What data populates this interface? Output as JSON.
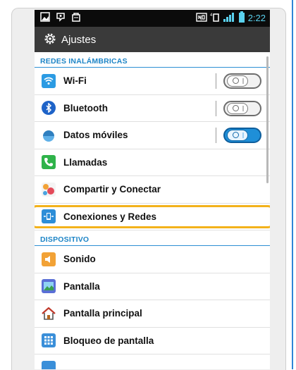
{
  "statusbar": {
    "clock": "2:22",
    "left_icons": [
      "gallery-icon",
      "sync-icon",
      "bag-icon"
    ],
    "right_icons": [
      "nfc-icon",
      "data-icon",
      "signal-icon",
      "battery-icon"
    ]
  },
  "titlebar": {
    "title": "Ajustes",
    "icon": "gear-icon"
  },
  "sections": [
    {
      "header": "REDES INALÁMBRICAS",
      "items": [
        {
          "label": "Wi-Fi",
          "icon": "wifi-icon",
          "icon_color": "#2b9be3",
          "toggle": "off"
        },
        {
          "label": "Bluetooth",
          "icon": "bluetooth-icon",
          "icon_color": "#1e63c8",
          "toggle": "off"
        },
        {
          "label": "Datos móviles",
          "icon": "mobile-data-icon",
          "icon_color": "#2f7fbf",
          "toggle": "on"
        },
        {
          "label": "Llamadas",
          "icon": "phone-icon",
          "icon_color": "#2fb34a"
        },
        {
          "label": "Compartir y Conectar",
          "icon": "share-icon",
          "icon_color": "#e44a5a"
        },
        {
          "label": "Conexiones y Redes",
          "icon": "network-icon",
          "icon_color": "#2d8ed8",
          "highlighted": true
        }
      ]
    },
    {
      "header": "DISPOSITIVO",
      "items": [
        {
          "label": "Sonido",
          "icon": "speaker-icon",
          "icon_color": "#f2a236"
        },
        {
          "label": "Pantalla",
          "icon": "display-icon",
          "icon_color": "#5a6fd6"
        },
        {
          "label": "Pantalla principal",
          "icon": "home-icon",
          "icon_color": "#c0392b"
        },
        {
          "label": "Bloqueo de pantalla",
          "icon": "lock-grid-icon",
          "icon_color": "#3a8fd9"
        }
      ]
    }
  ],
  "colors": {
    "accent": "#1c84c6",
    "highlight": "#f3b21b",
    "toggle_on": "#1f8fd8"
  }
}
